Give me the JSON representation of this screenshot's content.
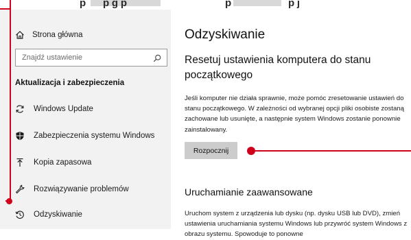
{
  "header_strip": {
    "fragments": [
      "p",
      "p  g    p",
      "p",
      "p  j"
    ]
  },
  "sidebar": {
    "home_label": "Strona główna",
    "search_placeholder": "Znajdź ustawienie",
    "section_title": "Aktualizacja i zabezpieczenia",
    "items": [
      {
        "label": "Windows Update",
        "icon": "sync-icon"
      },
      {
        "label": "Zabezpieczenia systemu Windows",
        "icon": "shield-icon"
      },
      {
        "label": "Kopia zapasowa",
        "icon": "upload-arrow-icon"
      },
      {
        "label": "Rozwiązywanie problemów",
        "icon": "wrench-icon"
      },
      {
        "label": "Odzyskiwanie",
        "icon": "history-icon"
      }
    ]
  },
  "main": {
    "title": "Odzyskiwanie",
    "reset": {
      "heading": "Resetuj ustawienia komputera do stanu początkowego",
      "description": "Jeśli komputer nie działa sprawnie, może pomóc zresetowanie ustawień do stanu początkowego. W zależności od wybranej opcji pliki osobiste zostaną zachowane lub usunięte, a następnie system Windows zostanie ponownie zainstalowany.",
      "button_label": "Rozpocznij"
    },
    "advanced": {
      "heading": "Uruchamianie zaawansowane",
      "description": "Uruchom system z urządzenia lub dysku (np. dysku USB lub DVD), zmień ustawienia uruchamiania systemu Windows lub przywróć system Windows z obrazu systemu. Spowoduje to ponowne"
    }
  },
  "colors": {
    "accent": "#d0021b",
    "sidebar_bg": "#f2f2f2",
    "button_bg": "#cccccc"
  }
}
